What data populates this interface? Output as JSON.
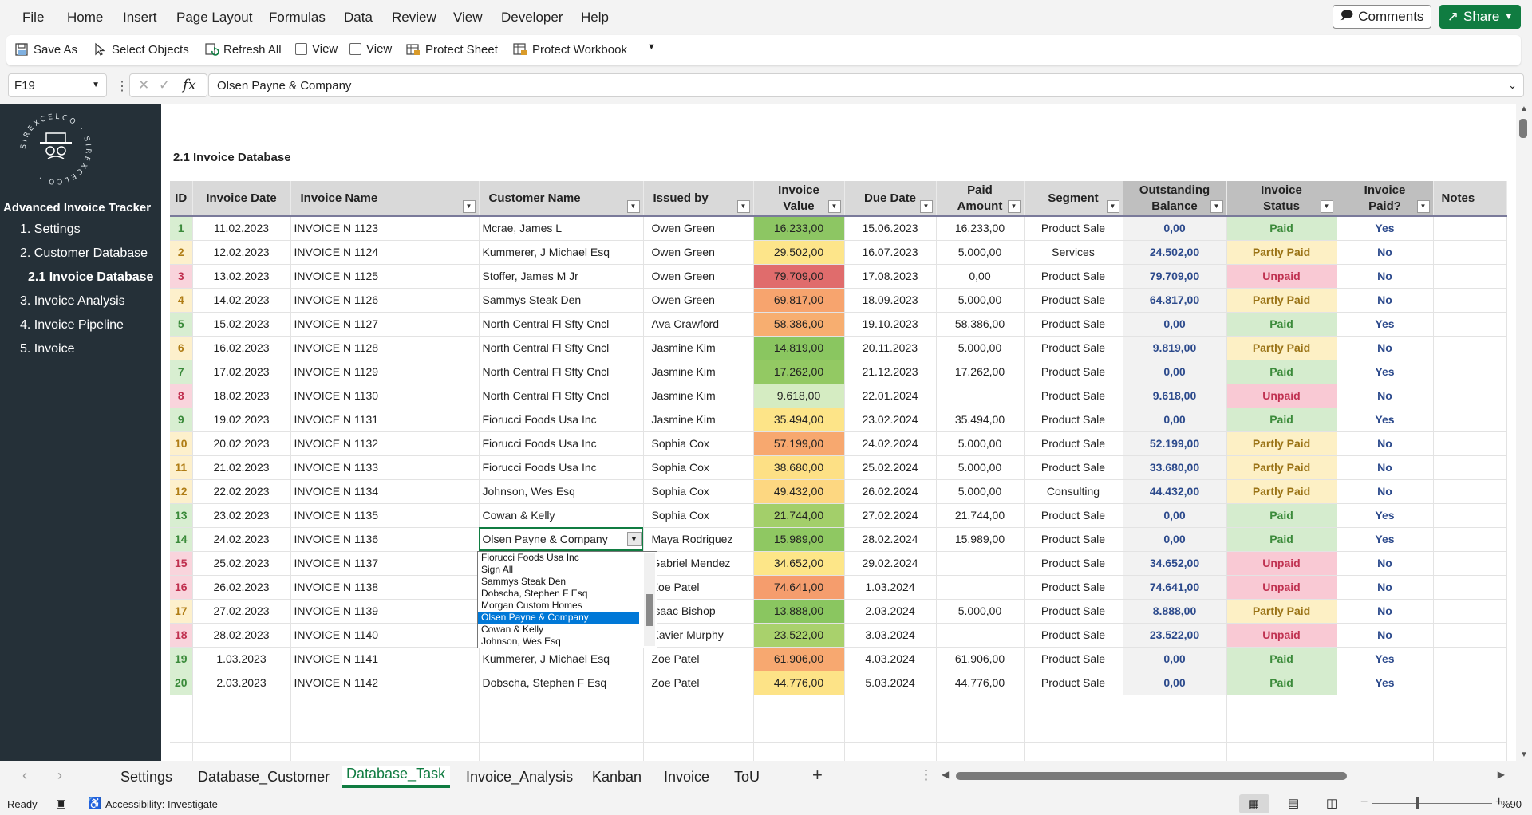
{
  "menu": [
    "File",
    "Home",
    "Insert",
    "Page Layout",
    "Formulas",
    "Data",
    "Review",
    "View",
    "Developer",
    "Help"
  ],
  "comments_label": "Comments",
  "share_label": "Share",
  "ribbon": {
    "save_as": "Save As",
    "select_objects": "Select Objects",
    "refresh_all": "Refresh All",
    "view1": "View",
    "view2": "View",
    "protect_sheet": "Protect Sheet",
    "protect_workbook": "Protect Workbook"
  },
  "formula_bar": {
    "name_box": "F19",
    "fx": "fx",
    "content": "Olsen Payne & Company"
  },
  "sidebar": {
    "logo_text": "SIREXCELCO",
    "title": "Advanced Invoice Tracker",
    "items": [
      "1. Settings",
      "2. Customer Database",
      "2.1 Invoice Database",
      "3. Invoice Analysis",
      "4. Invoice Pipeline",
      "5. Invoice"
    ]
  },
  "sheet_title": "2.1 Invoice Database",
  "columns": [
    "ID",
    "Invoice Date",
    "Invoice Name",
    "Customer Name",
    "Issued by",
    "Invoice Value",
    "Due Date",
    "Paid Amount",
    "Segment",
    "Outstanding Balance",
    "Invoice Status",
    "Invoice Paid?",
    "Notes"
  ],
  "rows": [
    {
      "id": "1",
      "date": "11.02.2023",
      "name": "INVOICE N 1123",
      "customer": "Mcrae, James L",
      "issued": "Owen Green",
      "value": "16.233,00",
      "due": "15.06.2023",
      "paid": "16.233,00",
      "segment": "Product Sale",
      "outstanding": "0,00",
      "status": "Paid",
      "paid_flag": "Yes",
      "value_color": "#8dc663",
      "status_class": "paid",
      "id_class": "g"
    },
    {
      "id": "2",
      "date": "12.02.2023",
      "name": "INVOICE N 1124",
      "customer": "Kummerer, J Michael Esq",
      "issued": "Owen Green",
      "value": "29.502,00",
      "due": "16.07.2023",
      "paid": "5.000,00",
      "segment": "Services",
      "outstanding": "24.502,00",
      "status": "Partly Paid",
      "paid_flag": "No",
      "value_color": "#fde58a",
      "status_class": "partly",
      "id_class": "y"
    },
    {
      "id": "3",
      "date": "13.02.2023",
      "name": "INVOICE N 1125",
      "customer": "Stoffer, James M Jr",
      "issued": "Owen Green",
      "value": "79.709,00",
      "due": "17.08.2023",
      "paid": "0,00",
      "segment": "Product Sale",
      "outstanding": "79.709,00",
      "status": "Unpaid",
      "paid_flag": "No",
      "value_color": "#e06c6c",
      "status_class": "unpaid",
      "id_class": "r"
    },
    {
      "id": "4",
      "date": "14.02.2023",
      "name": "INVOICE N 1126",
      "customer": "Sammys Steak Den",
      "issued": "Owen Green",
      "value": "69.817,00",
      "due": "18.09.2023",
      "paid": "5.000,00",
      "segment": "Product Sale",
      "outstanding": "64.817,00",
      "status": "Partly Paid",
      "paid_flag": "No",
      "value_color": "#f7a46e",
      "status_class": "partly",
      "id_class": "y"
    },
    {
      "id": "5",
      "date": "15.02.2023",
      "name": "INVOICE N 1127",
      "customer": "North Central Fl Sfty Cncl",
      "issued": "Ava Crawford",
      "value": "58.386,00",
      "due": "19.10.2023",
      "paid": "58.386,00",
      "segment": "Product Sale",
      "outstanding": "0,00",
      "status": "Paid",
      "paid_flag": "Yes",
      "value_color": "#f7ae70",
      "status_class": "paid",
      "id_class": "g"
    },
    {
      "id": "6",
      "date": "16.02.2023",
      "name": "INVOICE N 1128",
      "customer": "North Central Fl Sfty Cncl",
      "issued": "Jasmine Kim",
      "value": "14.819,00",
      "due": "20.11.2023",
      "paid": "5.000,00",
      "segment": "Product Sale",
      "outstanding": "9.819,00",
      "status": "Partly Paid",
      "paid_flag": "No",
      "value_color": "#8ac660",
      "status_class": "partly",
      "id_class": "y"
    },
    {
      "id": "7",
      "date": "17.02.2023",
      "name": "INVOICE N 1129",
      "customer": "North Central Fl Sfty Cncl",
      "issued": "Jasmine Kim",
      "value": "17.262,00",
      "due": "21.12.2023",
      "paid": "17.262,00",
      "segment": "Product Sale",
      "outstanding": "0,00",
      "status": "Paid",
      "paid_flag": "Yes",
      "value_color": "#93c963",
      "status_class": "paid",
      "id_class": "g"
    },
    {
      "id": "8",
      "date": "18.02.2023",
      "name": "INVOICE N 1130",
      "customer": "North Central Fl Sfty Cncl",
      "issued": "Jasmine Kim",
      "value": "9.618,00",
      "due": "22.01.2024",
      "paid": "",
      "segment": "Product Sale",
      "outstanding": "9.618,00",
      "status": "Unpaid",
      "paid_flag": "No",
      "value_color": "#d5ecc2",
      "status_class": "unpaid",
      "id_class": "r"
    },
    {
      "id": "9",
      "date": "19.02.2023",
      "name": "INVOICE N 1131",
      "customer": "Fiorucci Foods Usa Inc",
      "issued": "Jasmine Kim",
      "value": "35.494,00",
      "due": "23.02.2024",
      "paid": "35.494,00",
      "segment": "Product Sale",
      "outstanding": "0,00",
      "status": "Paid",
      "paid_flag": "Yes",
      "value_color": "#fde488",
      "status_class": "paid",
      "id_class": "g"
    },
    {
      "id": "10",
      "date": "20.02.2023",
      "name": "INVOICE N 1132",
      "customer": "Fiorucci Foods Usa Inc",
      "issued": "Sophia Cox",
      "value": "57.199,00",
      "due": "24.02.2024",
      "paid": "5.000,00",
      "segment": "Product Sale",
      "outstanding": "52.199,00",
      "status": "Partly Paid",
      "paid_flag": "No",
      "value_color": "#f7a86f",
      "status_class": "partly",
      "id_class": "y"
    },
    {
      "id": "11",
      "date": "21.02.2023",
      "name": "INVOICE N 1133",
      "customer": "Fiorucci Foods Usa Inc",
      "issued": "Sophia Cox",
      "value": "38.680,00",
      "due": "25.02.2024",
      "paid": "5.000,00",
      "segment": "Product Sale",
      "outstanding": "33.680,00",
      "status": "Partly Paid",
      "paid_flag": "No",
      "value_color": "#fde085",
      "status_class": "partly",
      "id_class": "y"
    },
    {
      "id": "12",
      "date": "22.02.2023",
      "name": "INVOICE N 1134",
      "customer": "Johnson, Wes Esq",
      "issued": "Sophia Cox",
      "value": "49.432,00",
      "due": "26.02.2024",
      "paid": "5.000,00",
      "segment": "Consulting",
      "outstanding": "44.432,00",
      "status": "Partly Paid",
      "paid_flag": "No",
      "value_color": "#fdd781",
      "status_class": "partly",
      "id_class": "y"
    },
    {
      "id": "13",
      "date": "23.02.2023",
      "name": "INVOICE N 1135",
      "customer": "Cowan & Kelly",
      "issued": "Sophia Cox",
      "value": "21.744,00",
      "due": "27.02.2024",
      "paid": "21.744,00",
      "segment": "Product Sale",
      "outstanding": "0,00",
      "status": "Paid",
      "paid_flag": "Yes",
      "value_color": "#a3cf6a",
      "status_class": "paid",
      "id_class": "g"
    },
    {
      "id": "14",
      "date": "24.02.2023",
      "name": "INVOICE N 1136",
      "customer": "Olsen Payne & Company",
      "issued": "Maya Rodriguez",
      "value": "15.989,00",
      "due": "28.02.2024",
      "paid": "15.989,00",
      "segment": "Product Sale",
      "outstanding": "0,00",
      "status": "Paid",
      "paid_flag": "Yes",
      "value_color": "#8fc862",
      "status_class": "paid",
      "id_class": "g"
    },
    {
      "id": "15",
      "date": "25.02.2023",
      "name": "INVOICE N 1137",
      "customer": "",
      "issued": "Gabriel Mendez",
      "value": "34.652,00",
      "due": "29.02.2024",
      "paid": "",
      "segment": "Product Sale",
      "outstanding": "34.652,00",
      "status": "Unpaid",
      "paid_flag": "No",
      "value_color": "#fde688",
      "status_class": "unpaid",
      "id_class": "r"
    },
    {
      "id": "16",
      "date": "26.02.2023",
      "name": "INVOICE N 1138",
      "customer": "",
      "issued": "Zoe Patel",
      "value": "74.641,00",
      "due": "1.03.2024",
      "paid": "",
      "segment": "Product Sale",
      "outstanding": "74.641,00",
      "status": "Unpaid",
      "paid_flag": "No",
      "value_color": "#f59d6d",
      "status_class": "unpaid",
      "id_class": "r"
    },
    {
      "id": "17",
      "date": "27.02.2023",
      "name": "INVOICE N 1139",
      "customer": "",
      "issued": "Isaac Bishop",
      "value": "13.888,00",
      "due": "2.03.2024",
      "paid": "5.000,00",
      "segment": "Product Sale",
      "outstanding": "8.888,00",
      "status": "Partly Paid",
      "paid_flag": "No",
      "value_color": "#8ac660",
      "status_class": "partly",
      "id_class": "y"
    },
    {
      "id": "18",
      "date": "28.02.2023",
      "name": "INVOICE N 1140",
      "customer": "",
      "issued": "Xavier Murphy",
      "value": "23.522,00",
      "due": "3.03.2024",
      "paid": "",
      "segment": "Product Sale",
      "outstanding": "23.522,00",
      "status": "Unpaid",
      "paid_flag": "No",
      "value_color": "#a9d16c",
      "status_class": "unpaid",
      "id_class": "r"
    },
    {
      "id": "19",
      "date": "1.03.2023",
      "name": "INVOICE N 1141",
      "customer": "Kummerer, J Michael Esq",
      "issued": "Zoe Patel",
      "value": "61.906,00",
      "due": "4.03.2024",
      "paid": "61.906,00",
      "segment": "Product Sale",
      "outstanding": "0,00",
      "status": "Paid",
      "paid_flag": "Yes",
      "value_color": "#f7a870",
      "status_class": "paid",
      "id_class": "g"
    },
    {
      "id": "20",
      "date": "2.03.2023",
      "name": "INVOICE N 1142",
      "customer": "Dobscha, Stephen F Esq",
      "issued": "Zoe Patel",
      "value": "44.776,00",
      "due": "5.03.2024",
      "paid": "44.776,00",
      "segment": "Product Sale",
      "outstanding": "0,00",
      "status": "Paid",
      "paid_flag": "Yes",
      "value_color": "#fde387",
      "status_class": "paid",
      "id_class": "g"
    }
  ],
  "dropdown_options": [
    "Fiorucci Foods Usa Inc",
    "Sign All",
    "Sammys Steak Den",
    "Dobscha, Stephen F Esq",
    "Morgan Custom Homes",
    "Olsen Payne & Company",
    "Cowan & Kelly",
    "Johnson, Wes Esq"
  ],
  "dropdown_selected": "Olsen Payne & Company",
  "sheet_tabs": [
    "Settings",
    "Database_Customer",
    "Database_Task",
    "Invoice_Analysis",
    "Kanban",
    "Invoice",
    "ToU"
  ],
  "active_tab": "Database_Task",
  "status": {
    "ready": "Ready",
    "accessibility": "Accessibility: Investigate",
    "zoom": "%90"
  }
}
